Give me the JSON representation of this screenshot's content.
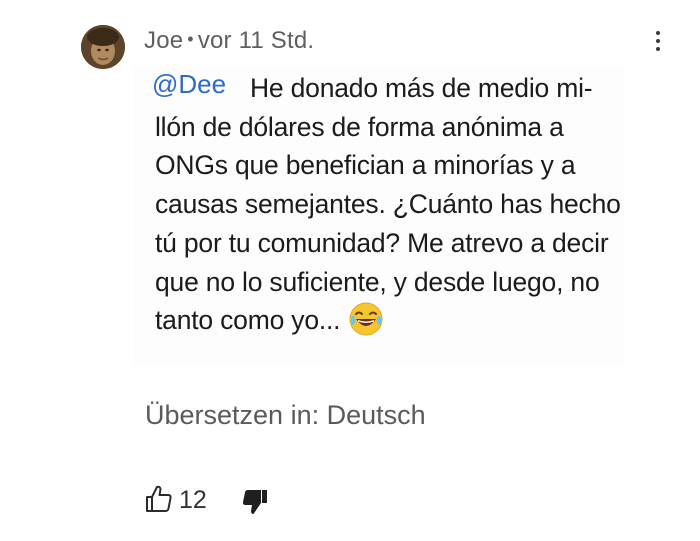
{
  "comment": {
    "author": "Joe",
    "separator": "•",
    "timestamp": "vor 11 Std.",
    "mention": "@Dee",
    "lines": [
      "He donado más de medio mi-",
      "llón de dólares de forma anónima a",
      "ONGs que benefician a minorías y a",
      "causas semejantes. ¿Cuánto has hecho",
      "tú por tu comunidad? Me atrevo a decir",
      "que no lo suficiente, y desde luego, no",
      "tanto como yo..."
    ],
    "emoji": "laughing-tears-emoji"
  },
  "translate": {
    "label": "Übersetzen in: Deutsch"
  },
  "actions": {
    "like_icon": "thumbs-up-icon",
    "like_count": "12",
    "dislike_icon": "thumbs-down-icon"
  },
  "colors": {
    "mention": "#2f6bc6",
    "meta_text": "#5f5f5f",
    "body_text": "#1b1b1b"
  }
}
